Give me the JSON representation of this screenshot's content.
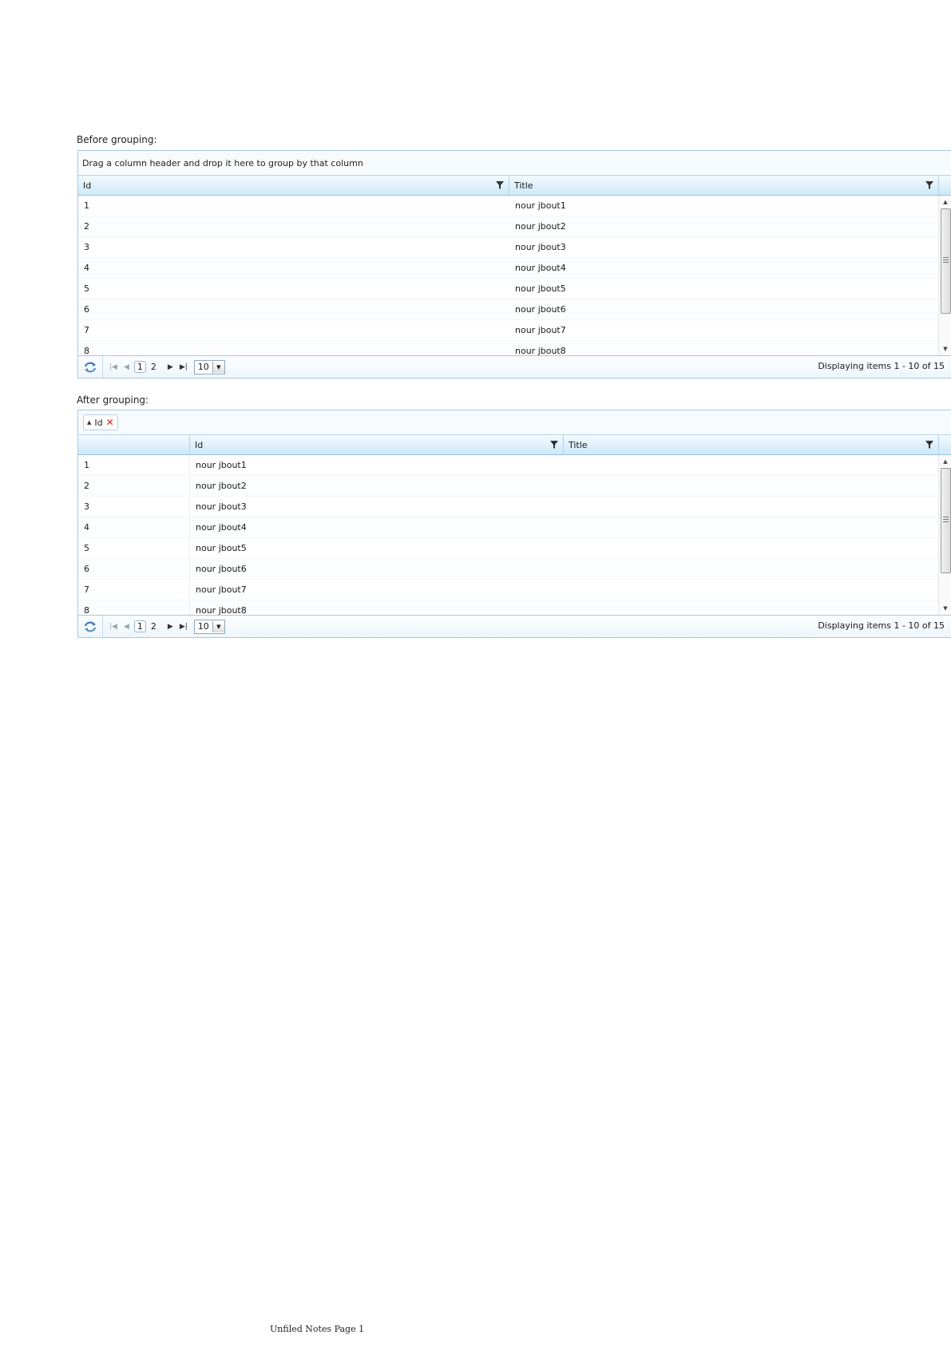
{
  "grid_before": {
    "caption": "Before grouping:",
    "group_panel_text": "Drag a column header and drop it here to group by that column",
    "columns": [
      "Id",
      "Title"
    ],
    "rows": [
      {
        "id": "1",
        "title": "nour jbout1"
      },
      {
        "id": "2",
        "title": "nour jbout2"
      },
      {
        "id": "3",
        "title": "nour jbout3"
      },
      {
        "id": "4",
        "title": "nour jbout4"
      },
      {
        "id": "5",
        "title": "nour jbout5"
      },
      {
        "id": "6",
        "title": "nour jbout6"
      },
      {
        "id": "7",
        "title": "nour jbout7"
      },
      {
        "id": "8",
        "title": "nour jbout8"
      }
    ],
    "pager": {
      "pages": [
        "1",
        "2"
      ],
      "current_page": "1",
      "page_size": "10",
      "status": "Displaying items 1 - 10 of 15"
    }
  },
  "grid_after": {
    "caption": "After grouping:",
    "group_chip": "Id",
    "columns": [
      "Id",
      "Title"
    ],
    "rows": [
      {
        "group": "1",
        "id": "nour jbout1"
      },
      {
        "group": "2",
        "id": "nour jbout2"
      },
      {
        "group": "3",
        "id": "nour jbout3"
      },
      {
        "group": "4",
        "id": "nour jbout4"
      },
      {
        "group": "5",
        "id": "nour jbout5"
      },
      {
        "group": "6",
        "id": "nour jbout6"
      },
      {
        "group": "7",
        "id": "nour jbout7"
      },
      {
        "group": "8",
        "id": "nour jbout8"
      }
    ],
    "pager": {
      "pages": [
        "1",
        "2"
      ],
      "current_page": "1",
      "page_size": "10",
      "status": "Displaying items 1 - 10 of 15"
    }
  },
  "footer": "Unfiled Notes Page 1",
  "icons": {
    "filter": "filter-icon",
    "refresh": "refresh-icon",
    "remove": "close-icon",
    "sort": "sort-ascending-icon"
  },
  "colors": {
    "header_gradient_top": "#f3fafe",
    "header_gradient_bottom": "#cfe8f9",
    "border": "#a7c9e0",
    "remove_red": "#d31a1a"
  }
}
